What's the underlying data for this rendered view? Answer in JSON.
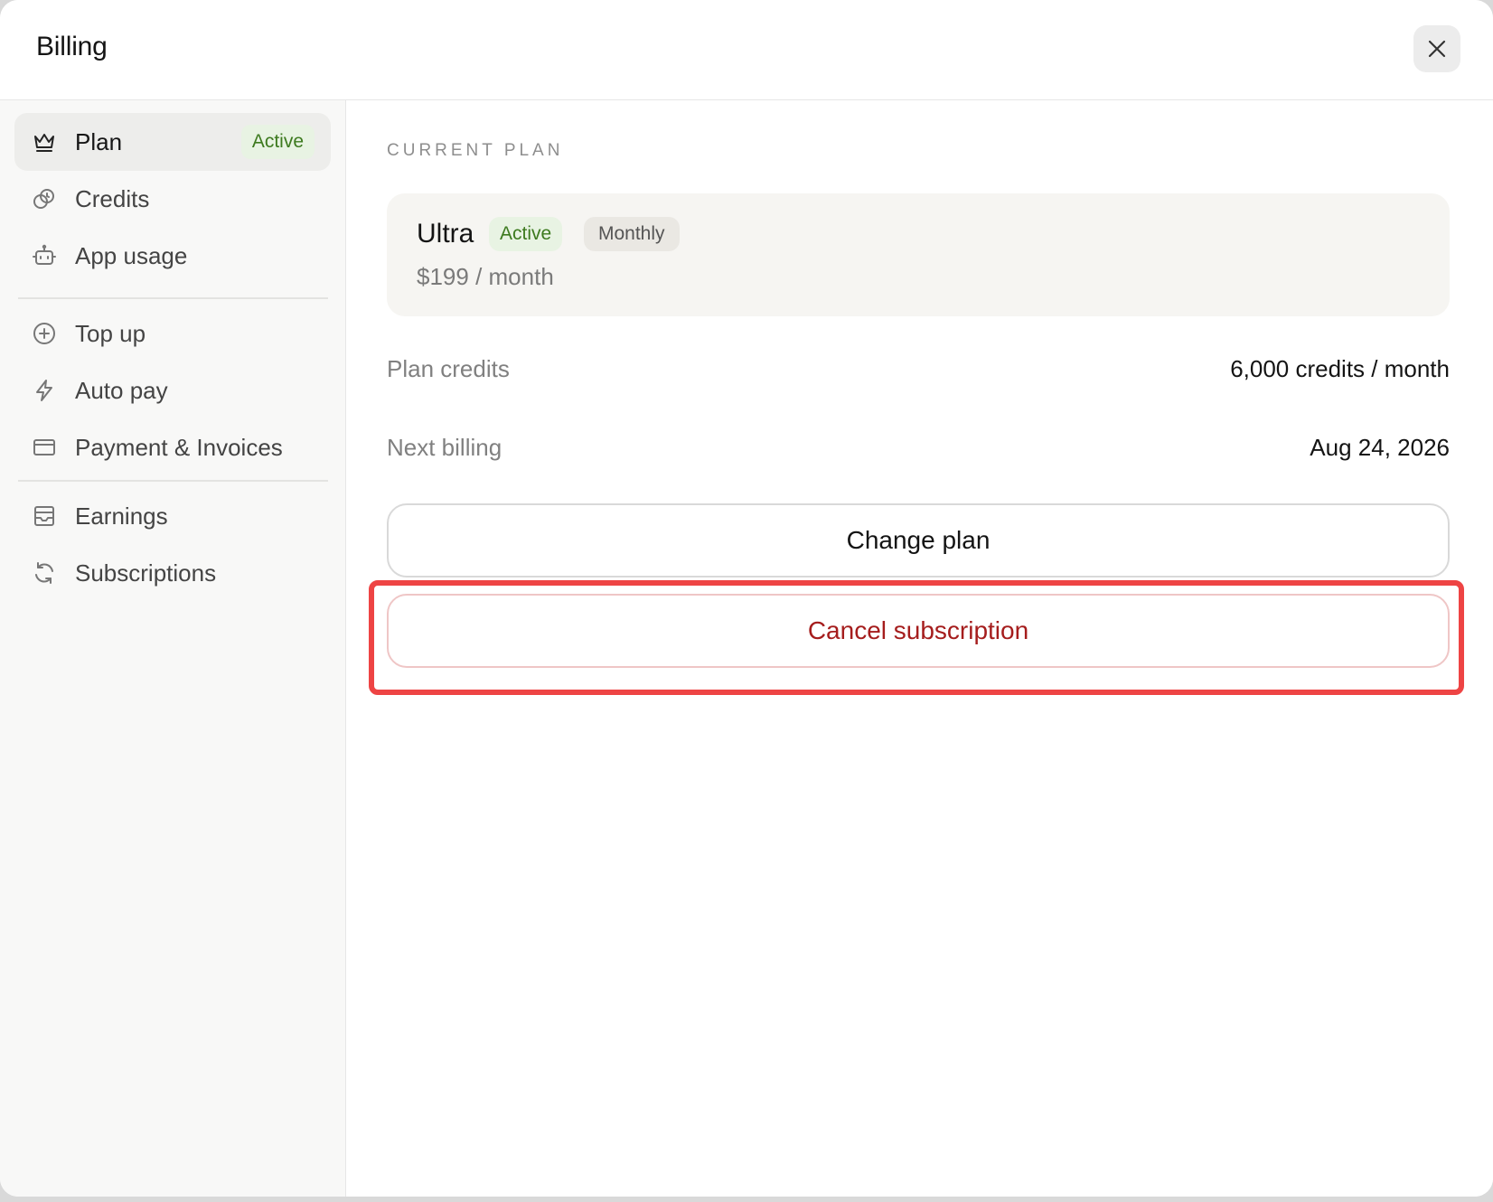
{
  "modal": {
    "title": "Billing",
    "close_icon": "close-icon"
  },
  "sidebar": {
    "items": [
      {
        "key": "plan",
        "label": "Plan",
        "icon": "crown-icon",
        "badge": "Active",
        "active": true
      },
      {
        "key": "credits",
        "label": "Credits",
        "icon": "coins-icon"
      },
      {
        "key": "app-usage",
        "label": "App usage",
        "icon": "bot-icon"
      },
      {
        "key": "top-up",
        "label": "Top up",
        "icon": "plus-circle-icon"
      },
      {
        "key": "auto-pay",
        "label": "Auto pay",
        "icon": "lightning-icon"
      },
      {
        "key": "payment-invoices",
        "label": "Payment & Invoices",
        "icon": "credit-card-icon"
      },
      {
        "key": "earnings",
        "label": "Earnings",
        "icon": "inbox-icon"
      },
      {
        "key": "subscriptions",
        "label": "Subscriptions",
        "icon": "refresh-icon"
      }
    ]
  },
  "main": {
    "section_label": "CURRENT PLAN",
    "plan": {
      "name": "Ultra",
      "status": "Active",
      "cycle": "Monthly",
      "price": "$199 / month"
    },
    "rows": {
      "plan_credits": {
        "label": "Plan credits",
        "value": "6,000 credits / month"
      },
      "next_billing": {
        "label": "Next billing",
        "value": "Aug 24, 2026"
      }
    },
    "buttons": {
      "change_plan": "Change plan",
      "cancel_subscription": "Cancel subscription"
    }
  },
  "colors": {
    "accent_green": "#3d7a1f",
    "danger_red": "#a51d1d",
    "highlight": "#ee4444"
  }
}
